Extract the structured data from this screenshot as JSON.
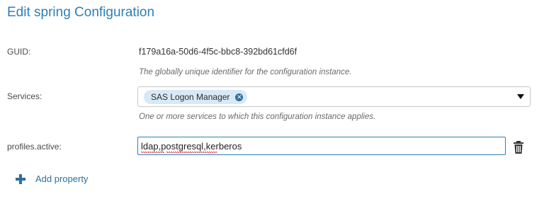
{
  "dialog": {
    "title": "Edit spring Configuration"
  },
  "guid": {
    "label": "GUID:",
    "value": "f179a16a-50d6-4f5c-bbc8-392bd61cfd6f",
    "hint": "The globally unique identifier for the configuration instance."
  },
  "services": {
    "label": "Services:",
    "selected": [
      "SAS Logon Manager"
    ],
    "hint": "One or more services to which this configuration instance applies."
  },
  "profiles_active": {
    "label": "profiles.active:",
    "value": "ldap,postgresql,kerberos"
  },
  "actions": {
    "add_property_label": "Add property"
  },
  "icons": {
    "chip_remove": "close-circle-icon",
    "dropdown": "chevron-down-icon",
    "delete": "trash-icon",
    "add": "plus-icon"
  },
  "colors": {
    "accent": "#2f7fb5",
    "chip_bg": "#d7e9f6",
    "link": "#2f6f9f"
  }
}
